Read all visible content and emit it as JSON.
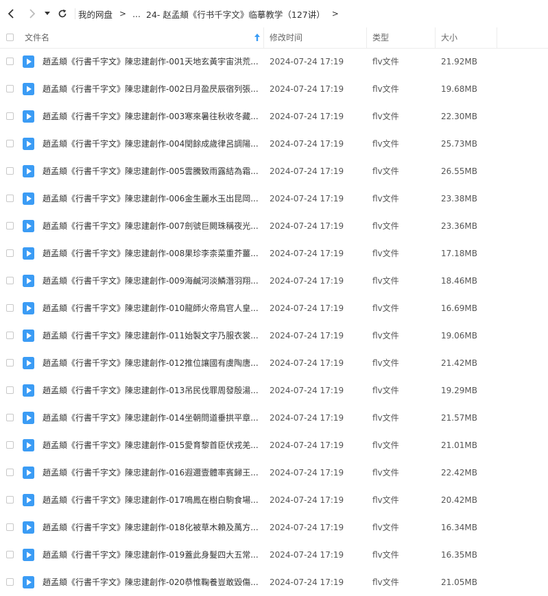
{
  "nav": {
    "back_icon": "chevron-left-icon",
    "forward_icon": "chevron-right-icon",
    "dropdown_icon": "caret-down-icon",
    "refresh_icon": "refresh-icon"
  },
  "breadcrumb": {
    "root": "我的网盘",
    "ellipsis": "...",
    "current": "24- 赵孟頫《行书千字文》临摹教学（127讲）"
  },
  "table": {
    "columns": {
      "name": "文件名",
      "modified": "修改时间",
      "type": "类型",
      "size": "大小"
    },
    "rows": [
      {
        "name": "趙孟頫《行書千字文》陳忠建創作-001天地玄黃宇宙洪荒...",
        "modified": "2024-07-24 17:19",
        "type": "flv文件",
        "size": "21.92MB"
      },
      {
        "name": "趙孟頫《行書千字文》陳忠建創作-002日月盈昃辰宿列張...",
        "modified": "2024-07-24 17:19",
        "type": "flv文件",
        "size": "19.68MB"
      },
      {
        "name": "趙孟頫《行書千字文》陳忠建創作-003寒來暑往秋收冬藏...",
        "modified": "2024-07-24 17:19",
        "type": "flv文件",
        "size": "22.30MB"
      },
      {
        "name": "趙孟頫《行書千字文》陳忠建創作-004閏餘成歲律呂調陽...",
        "modified": "2024-07-24 17:19",
        "type": "flv文件",
        "size": "25.73MB"
      },
      {
        "name": "趙孟頫《行書千字文》陳忠建創作-005雲騰致雨露結為霜...",
        "modified": "2024-07-24 17:19",
        "type": "flv文件",
        "size": "26.55MB"
      },
      {
        "name": "趙孟頫《行書千字文》陳忠建創作-006金生麗水玉出昆岡...",
        "modified": "2024-07-24 17:19",
        "type": "flv文件",
        "size": "23.38MB"
      },
      {
        "name": "趙孟頫《行書千字文》陳忠建創作-007劍號巨闕珠稱夜光...",
        "modified": "2024-07-24 17:19",
        "type": "flv文件",
        "size": "23.36MB"
      },
      {
        "name": "趙孟頫《行書千字文》陳忠建創作-008果珍李柰菜重芥薑...",
        "modified": "2024-07-24 17:19",
        "type": "flv文件",
        "size": "17.18MB"
      },
      {
        "name": "趙孟頫《行書千字文》陳忠建創作-009海鹹河淡鱗潛羽翔...",
        "modified": "2024-07-24 17:19",
        "type": "flv文件",
        "size": "18.46MB"
      },
      {
        "name": "趙孟頫《行書千字文》陳忠建創作-010龍師火帝鳥官人皇...",
        "modified": "2024-07-24 17:19",
        "type": "flv文件",
        "size": "16.69MB"
      },
      {
        "name": "趙孟頫《行書千字文》陳忠建創作-011始製文字乃服衣裳...",
        "modified": "2024-07-24 17:19",
        "type": "flv文件",
        "size": "19.06MB"
      },
      {
        "name": "趙孟頫《行書千字文》陳忠建創作-012推位讓國有虞陶唐...",
        "modified": "2024-07-24 17:19",
        "type": "flv文件",
        "size": "21.42MB"
      },
      {
        "name": "趙孟頫《行書千字文》陳忠建創作-013吊民伐罪周發殷湯...",
        "modified": "2024-07-24 17:19",
        "type": "flv文件",
        "size": "19.29MB"
      },
      {
        "name": "趙孟頫《行書千字文》陳忠建創作-014坐朝問道垂拱平章...",
        "modified": "2024-07-24 17:19",
        "type": "flv文件",
        "size": "21.57MB"
      },
      {
        "name": "趙孟頫《行書千字文》陳忠建創作-015愛育黎首臣伏戎羌...",
        "modified": "2024-07-24 17:19",
        "type": "flv文件",
        "size": "21.01MB"
      },
      {
        "name": "趙孟頫《行書千字文》陳忠建創作-016遐邇壹體率賓歸王...",
        "modified": "2024-07-24 17:19",
        "type": "flv文件",
        "size": "22.42MB"
      },
      {
        "name": "趙孟頫《行書千字文》陳忠建創作-017鳴鳳在樹白駒食場...",
        "modified": "2024-07-24 17:19",
        "type": "flv文件",
        "size": "20.42MB"
      },
      {
        "name": "趙孟頫《行書千字文》陳忠建創作-018化被草木賴及萬方...",
        "modified": "2024-07-24 17:19",
        "type": "flv文件",
        "size": "16.34MB"
      },
      {
        "name": "趙孟頫《行書千字文》陳忠建創作-019蓋此身髮四大五常...",
        "modified": "2024-07-24 17:19",
        "type": "flv文件",
        "size": "16.35MB"
      },
      {
        "name": "趙孟頫《行書千字文》陳忠建創作-020恭惟鞠養豈敢毀傷...",
        "modified": "2024-07-24 17:19",
        "type": "flv文件",
        "size": "21.05MB"
      }
    ]
  },
  "colors": {
    "file_icon": "#3b9cf5",
    "sort_arrow": "#3b9cf5",
    "border": "#ececec"
  },
  "icons": {
    "file": "video-file-icon",
    "sort": "sort-ascending-icon"
  }
}
